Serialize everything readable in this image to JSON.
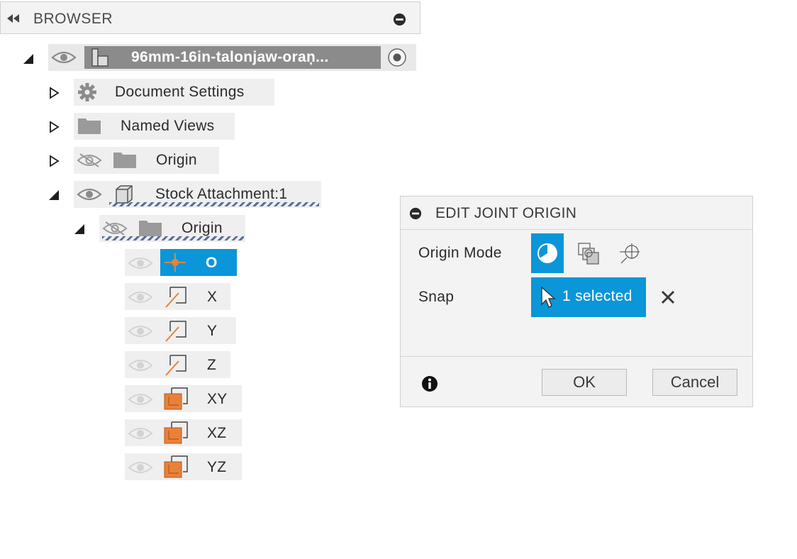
{
  "browser": {
    "title": "BROWSER",
    "root": {
      "label": "96mm-16in-talonjaw-oraņ..."
    },
    "items": [
      {
        "label": "Document Settings"
      },
      {
        "label": "Named Views"
      },
      {
        "label": "Origin"
      },
      {
        "label": "Stock Attachment:1"
      },
      {
        "label": "Origin"
      }
    ],
    "origin_children": [
      {
        "label": "O",
        "selected": true
      },
      {
        "label": "X"
      },
      {
        "label": "Y"
      },
      {
        "label": "Z"
      },
      {
        "label": "XY"
      },
      {
        "label": "XZ"
      },
      {
        "label": "YZ"
      }
    ]
  },
  "dialog": {
    "title": "EDIT JOINT ORIGIN",
    "origin_mode_label": "Origin Mode",
    "snap_label": "Snap",
    "snap_value": "1 selected",
    "ok_label": "OK",
    "cancel_label": "Cancel"
  },
  "colors": {
    "accent": "#0a96d8",
    "orange": "#e8823a",
    "dash": "#5a6f9a"
  }
}
